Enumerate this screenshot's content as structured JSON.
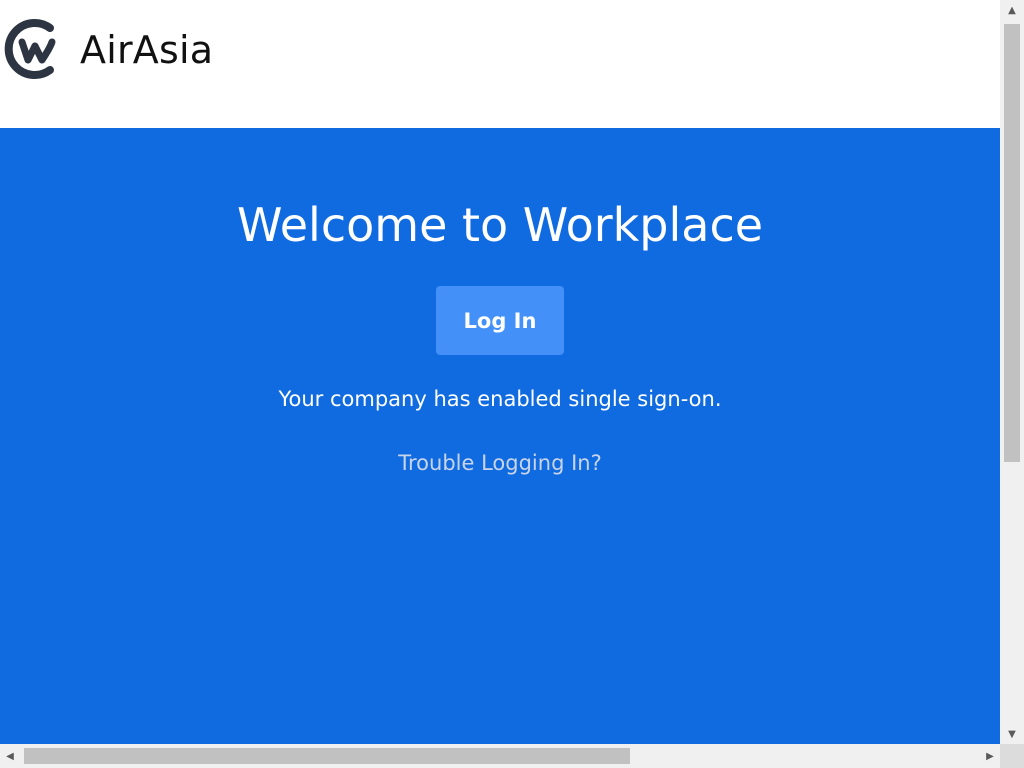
{
  "header": {
    "brand_name": "AirAsia",
    "logo_icon": "workplace-logo-icon"
  },
  "hero": {
    "title": "Welcome to Workplace",
    "login_label": "Log In",
    "sso_message": "Your company has enabled single sign-on.",
    "trouble_link": "Trouble Logging In?"
  },
  "colors": {
    "hero_background": "#106be1",
    "login_button": "#4490f9",
    "trouble_link": "#c9d4e8",
    "logo": "#2d3542"
  },
  "scrollbars": {
    "up_icon": "arrow-up-icon",
    "down_icon": "arrow-down-icon",
    "left_icon": "arrow-left-icon",
    "right_icon": "arrow-right-icon"
  }
}
